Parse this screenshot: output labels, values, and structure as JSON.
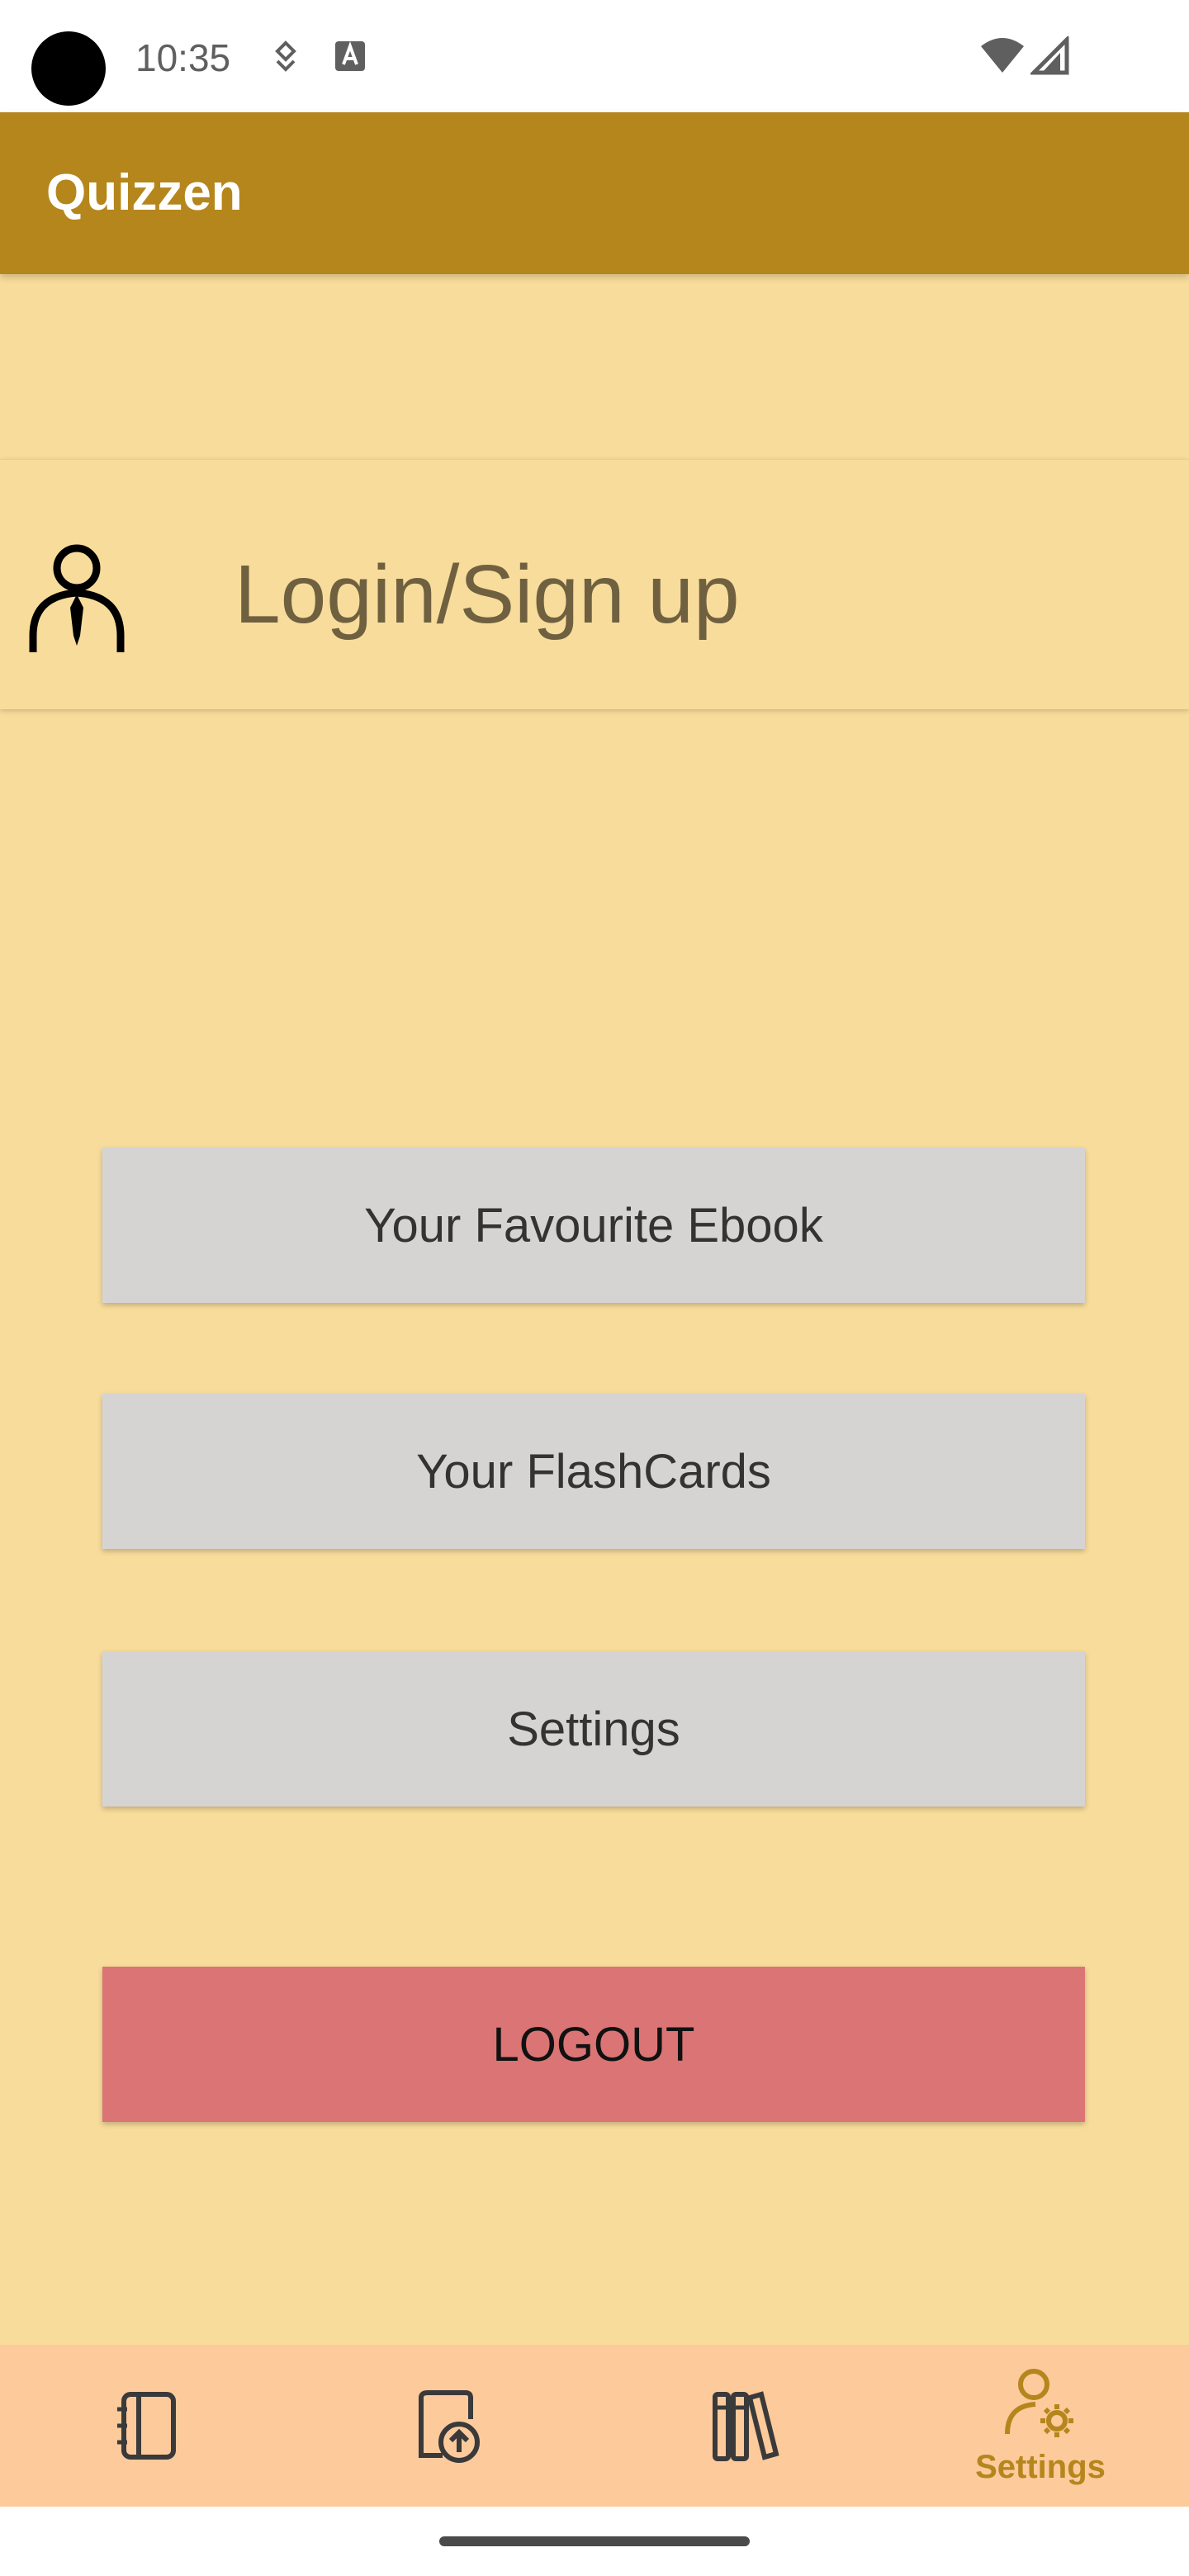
{
  "status_bar": {
    "time": "10:35"
  },
  "app_bar": {
    "title": "Quizzen"
  },
  "login": {
    "label": "Login/Sign up",
    "icon": "person-tie-icon"
  },
  "menu": {
    "favourite_ebook_label": "Your Favourite Ebook",
    "flashcards_label": "Your FlashCards",
    "settings_label": "Settings",
    "logout_label": "LOGOUT"
  },
  "bottom_nav": {
    "items": [
      {
        "icon": "notebook-icon",
        "label": ""
      },
      {
        "icon": "upload-document-icon",
        "label": ""
      },
      {
        "icon": "library-books-icon",
        "label": ""
      },
      {
        "icon": "user-settings-icon",
        "label": "Settings",
        "active": true
      }
    ]
  },
  "colors": {
    "app_bar": "#b5861c",
    "background": "#f8dc9b",
    "button": "#d6d4d3",
    "logout": "#db7474",
    "bottom_nav": "#fdca9c",
    "accent": "#b5861c"
  }
}
